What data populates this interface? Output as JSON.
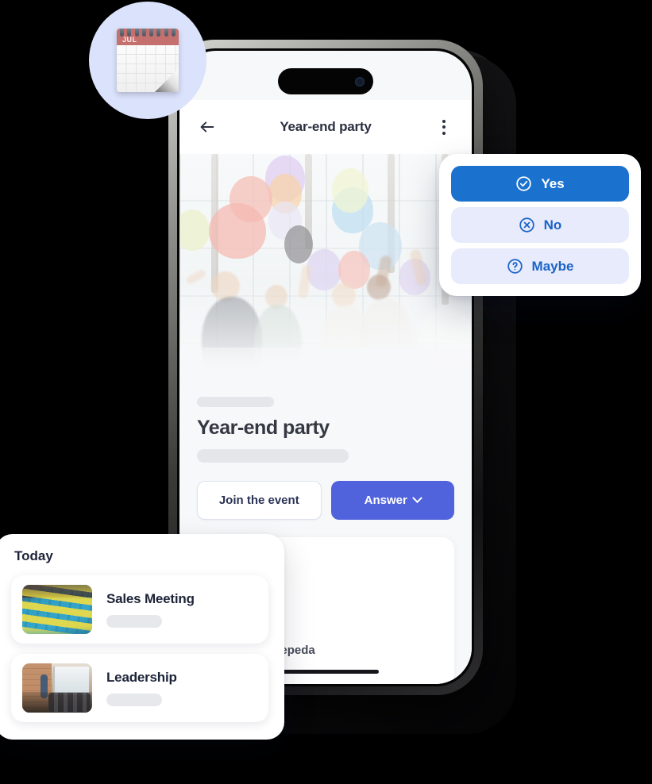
{
  "device": {
    "name": "smartphone-mockup",
    "dynamic_island": "dynamic-island",
    "home_indicator": "home-indicator"
  },
  "appbar": {
    "back_icon": "back-arrow-icon",
    "title": "Year-end party",
    "menu_icon": "more-vertical-icon"
  },
  "hero": {
    "alt": "people celebrating with colorful balloons",
    "icon": "party-photo"
  },
  "event": {
    "title": "Year-end party",
    "skeleton_top": "",
    "skeleton_sub": "",
    "join_label": "Join the event",
    "answer_label": "Answer",
    "answer_chevron_icon": "chevron-down-icon",
    "guest_name": "uis Pedro Cepeda"
  },
  "rsvp": {
    "options": [
      {
        "label": "Yes",
        "icon": "check-circle-icon",
        "style": "primary"
      },
      {
        "label": "No",
        "icon": "x-circle-icon",
        "style": "secondary"
      },
      {
        "label": "Maybe",
        "icon": "question-circle-icon",
        "style": "secondary"
      }
    ]
  },
  "calendar_badge": {
    "icon": "calendar-icon",
    "month": "JUL"
  },
  "today": {
    "title": "Today",
    "items": [
      {
        "title": "Sales Meeting",
        "thumb_icon": "sticky-notes-photo",
        "skeleton": ""
      },
      {
        "title": "Leadership",
        "thumb_icon": "office-presentation-photo",
        "skeleton": ""
      }
    ]
  },
  "colors": {
    "background": "#000000",
    "screen_bg": "#f7f8fa",
    "primary_blue": "#5063dc",
    "rsvp_yes_blue": "#1b72ce",
    "rsvp_secondary_bg": "#e7ebfb",
    "rsvp_secondary_text": "#1b63c9",
    "badge_circle": "#dbe2fb",
    "text_dark": "#1d2438",
    "skeleton_gray": "#e4e6e9"
  }
}
